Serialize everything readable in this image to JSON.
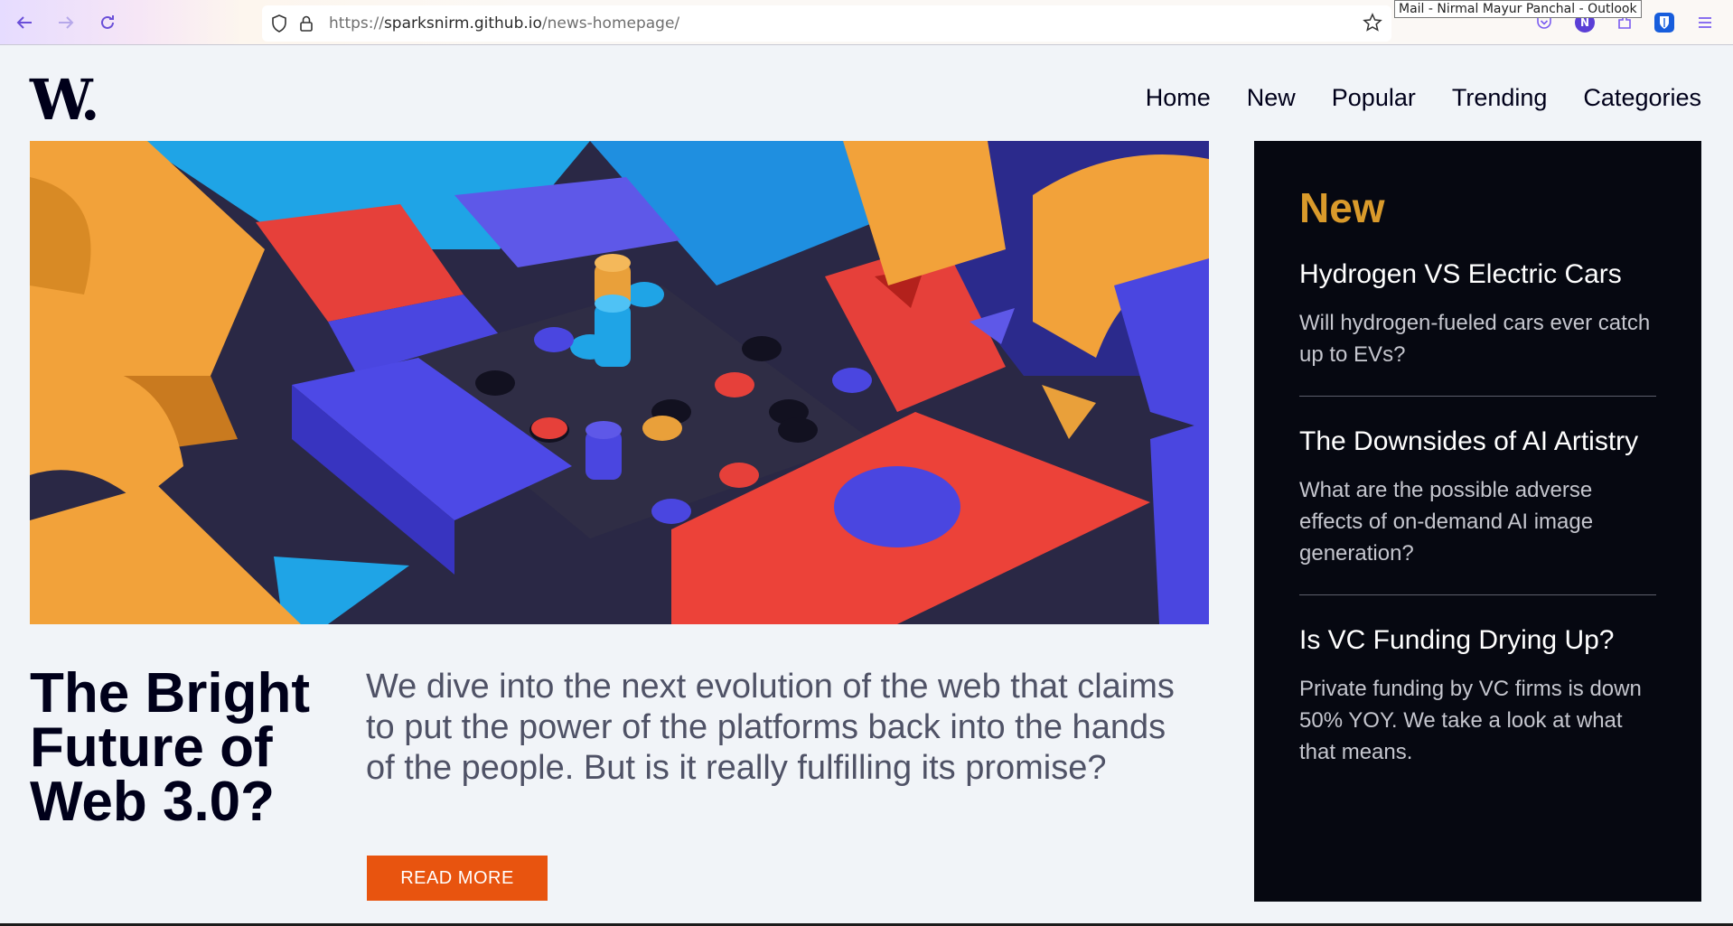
{
  "browser": {
    "url_prefix": "https://",
    "url_host": "sparksnirm.github.io",
    "url_path": "/news-homepage/",
    "tooltip": "Mail - Nirmal Mayur Panchal - Outlook",
    "icons": [
      "back-arrow-icon",
      "forward-arrow-icon",
      "reload-icon",
      "shield-icon",
      "lock-icon",
      "star-icon",
      "pocket-icon",
      "profile-n-icon",
      "extensions-icon",
      "bitwarden-icon",
      "menu-icon"
    ]
  },
  "header": {
    "logo": "W.",
    "nav": [
      "Home",
      "New",
      "Popular",
      "Trending",
      "Categories"
    ]
  },
  "main": {
    "headline": "The Bright Future of Web 3.0?",
    "description": "We dive into the next evolution of the web that claims to put the power of the platforms back into the hands of the people. But is it really fulfilling its promise?",
    "cta": "READ MORE"
  },
  "sidebar": {
    "title": "New",
    "items": [
      {
        "title": "Hydrogen VS Electric Cars",
        "text": "Will hydrogen-fueled cars ever catch up to EVs?"
      },
      {
        "title": "The Downsides of AI Artistry",
        "text": "What are the possible adverse effects of on-demand AI image generation?"
      },
      {
        "title": "Is VC Funding Drying Up?",
        "text": "Private funding by VC firms is down 50% YOY. We take a look at what that means."
      }
    ]
  },
  "colors": {
    "accent": "#e8540f",
    "sidebar_bg": "#060811",
    "sidebar_title": "#d99a2b",
    "page_bg": "#f1f4f8"
  }
}
